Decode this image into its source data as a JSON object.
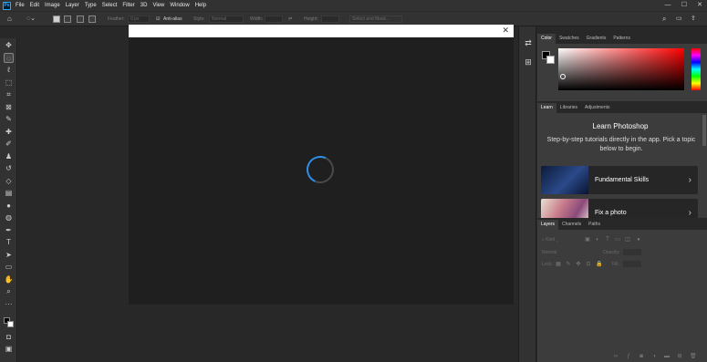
{
  "app": {
    "logo": "Ps"
  },
  "menu": [
    "File",
    "Edit",
    "Image",
    "Layer",
    "Type",
    "Select",
    "Filter",
    "3D",
    "View",
    "Window",
    "Help"
  ],
  "window_controls": {
    "minimize": "—",
    "maximize": "☐",
    "close": "✕"
  },
  "options": {
    "feather_label": "Feather:",
    "feather_value": "0 px",
    "anti_alias_label": "Anti-alias",
    "style_label": "Style:",
    "style_value": "Normal",
    "width_label": "Width:",
    "height_label": "Height:",
    "select_mask_label": "Select and Mask..."
  },
  "tools": [
    "move-icon",
    "marquee-icon",
    "lasso-icon",
    "object-select-icon",
    "crop-icon",
    "frame-icon",
    "eyedropper-icon",
    "healing-icon",
    "brush-icon",
    "stamp-icon",
    "history-brush-icon",
    "eraser-icon",
    "gradient-icon",
    "blur-icon",
    "dodge-icon",
    "pen-icon",
    "type-icon",
    "path-select-icon",
    "rectangle-icon",
    "hand-icon",
    "zoom-icon",
    "more-icon",
    "color-swatch-icon",
    "quickmask-icon",
    "screen-mode-icon"
  ],
  "dialog": {
    "close": "✕"
  },
  "color_panel": {
    "tabs": [
      "Color",
      "Swatches",
      "Gradients",
      "Patterns"
    ],
    "active": "Color",
    "foreground": "#000000",
    "background": "#ffffff",
    "hue": "#ff0000"
  },
  "learn_panel": {
    "tabs": [
      "Learn",
      "Libraries",
      "Adjustments"
    ],
    "active": "Learn",
    "title": "Learn Photoshop",
    "description": "Step-by-step tutorials directly in the app. Pick a topic below to begin.",
    "cards": [
      {
        "label": "Fundamental Skills",
        "chevron": "›"
      },
      {
        "label": "Fix a photo",
        "chevron": "›"
      }
    ]
  },
  "layers_panel": {
    "tabs": [
      "Layers",
      "Channels",
      "Paths"
    ],
    "active": "Layers",
    "kind_label": "Kind",
    "blend_mode": "Normal",
    "opacity_label": "Opacity:",
    "lock_label": "Lock:",
    "fill_label": "Fill:"
  }
}
